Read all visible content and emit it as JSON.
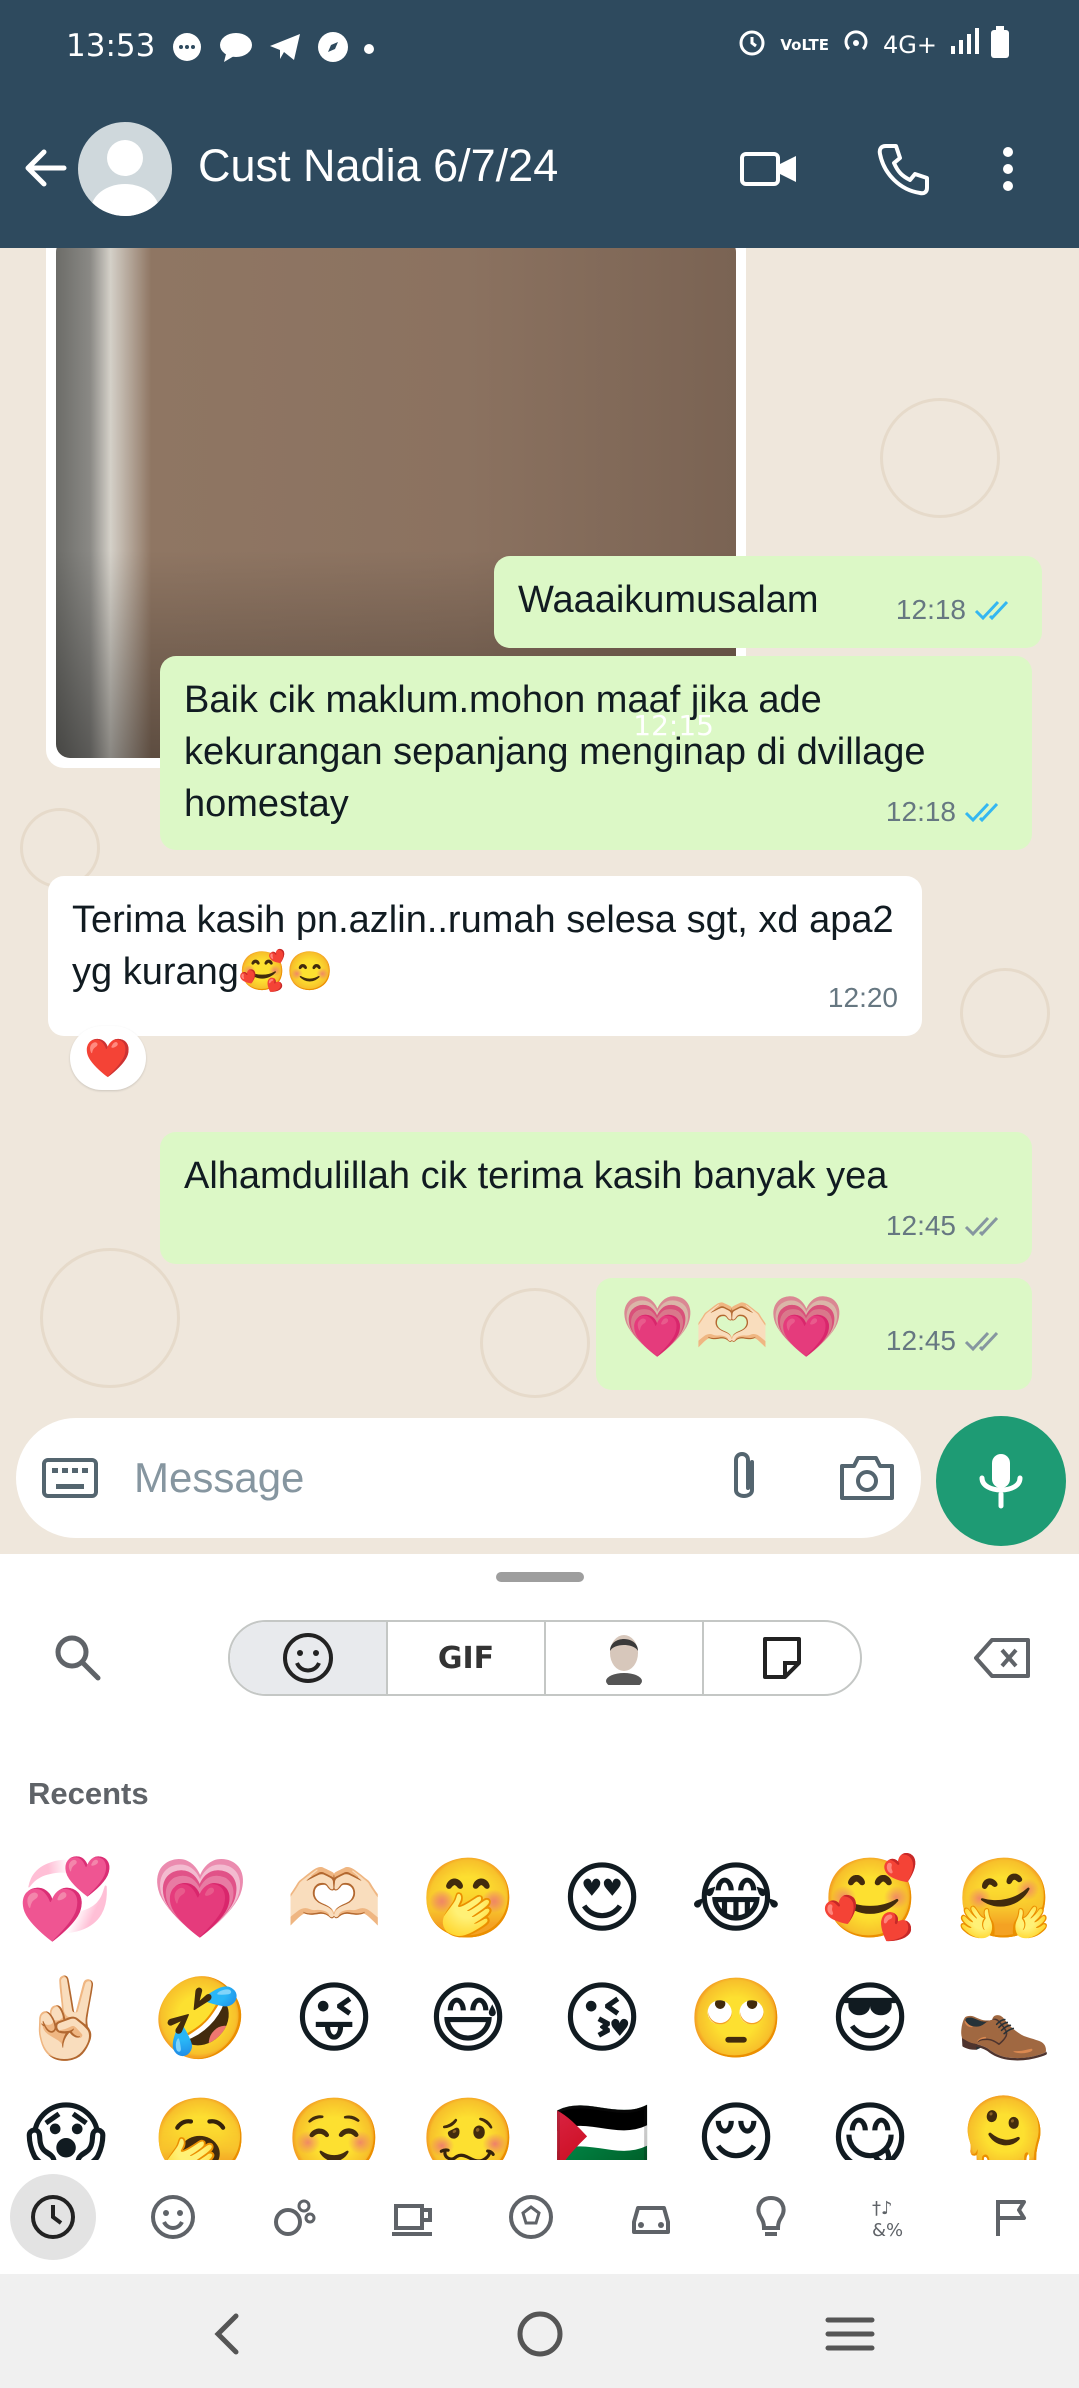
{
  "status": {
    "time": "13:53",
    "network": "4G+",
    "volte": "VoLTE"
  },
  "header": {
    "title": "Cust Nadia 6/7/24"
  },
  "messages": [
    {
      "id": "photo",
      "time": "12:15"
    },
    {
      "id": "m1",
      "dir": "out",
      "text": "Waaaikumusalam",
      "time": "12:18",
      "ticks": "read"
    },
    {
      "id": "m2",
      "dir": "out",
      "text": "Baik cik maklum.mohon maaf jika ade kekurangan sepanjang menginap di dvillage homestay",
      "time": "12:18",
      "ticks": "read"
    },
    {
      "id": "m3",
      "dir": "in",
      "text": "Terima kasih pn.azlin..rumah selesa sgt, xd apa2 yg kurang🥰😊",
      "time": "12:20",
      "reaction": "❤️"
    },
    {
      "id": "m4",
      "dir": "out",
      "text": "Alhamdulillah cik terima kasih banyak yea",
      "time": "12:45",
      "ticks": "delivered"
    },
    {
      "id": "m5",
      "dir": "out",
      "text": "💗🫶🏻💗",
      "time": "12:45",
      "ticks": "delivered"
    }
  ],
  "input": {
    "placeholder": "Message"
  },
  "emoji_panel": {
    "tabs": [
      "emoji",
      "GIF",
      "avatar",
      "sticker"
    ],
    "gif_label": "GIF",
    "section_title": "Recents",
    "recents": [
      "💞",
      "💗",
      "🫶🏻",
      "🤭",
      "😍",
      "😂",
      "🥰",
      "🤗",
      "✌🏻",
      "🤣",
      "😜",
      "😅",
      "😘",
      "🙄",
      "😎",
      "👞",
      "😱",
      "🥱",
      "☺️",
      "🥴",
      "🇵🇸",
      "😌",
      "😋",
      "🫠"
    ],
    "categories": [
      "recent-icon",
      "smiley-icon",
      "animals-icon",
      "food-icon",
      "activity-icon",
      "travel-icon",
      "objects-icon",
      "symbols-icon",
      "flags-icon"
    ]
  },
  "colors": {
    "header": "#2e4a5e",
    "outgoing": "#dcf8c6",
    "accent": "#1e9b74",
    "read_tick": "#34b7f1"
  }
}
